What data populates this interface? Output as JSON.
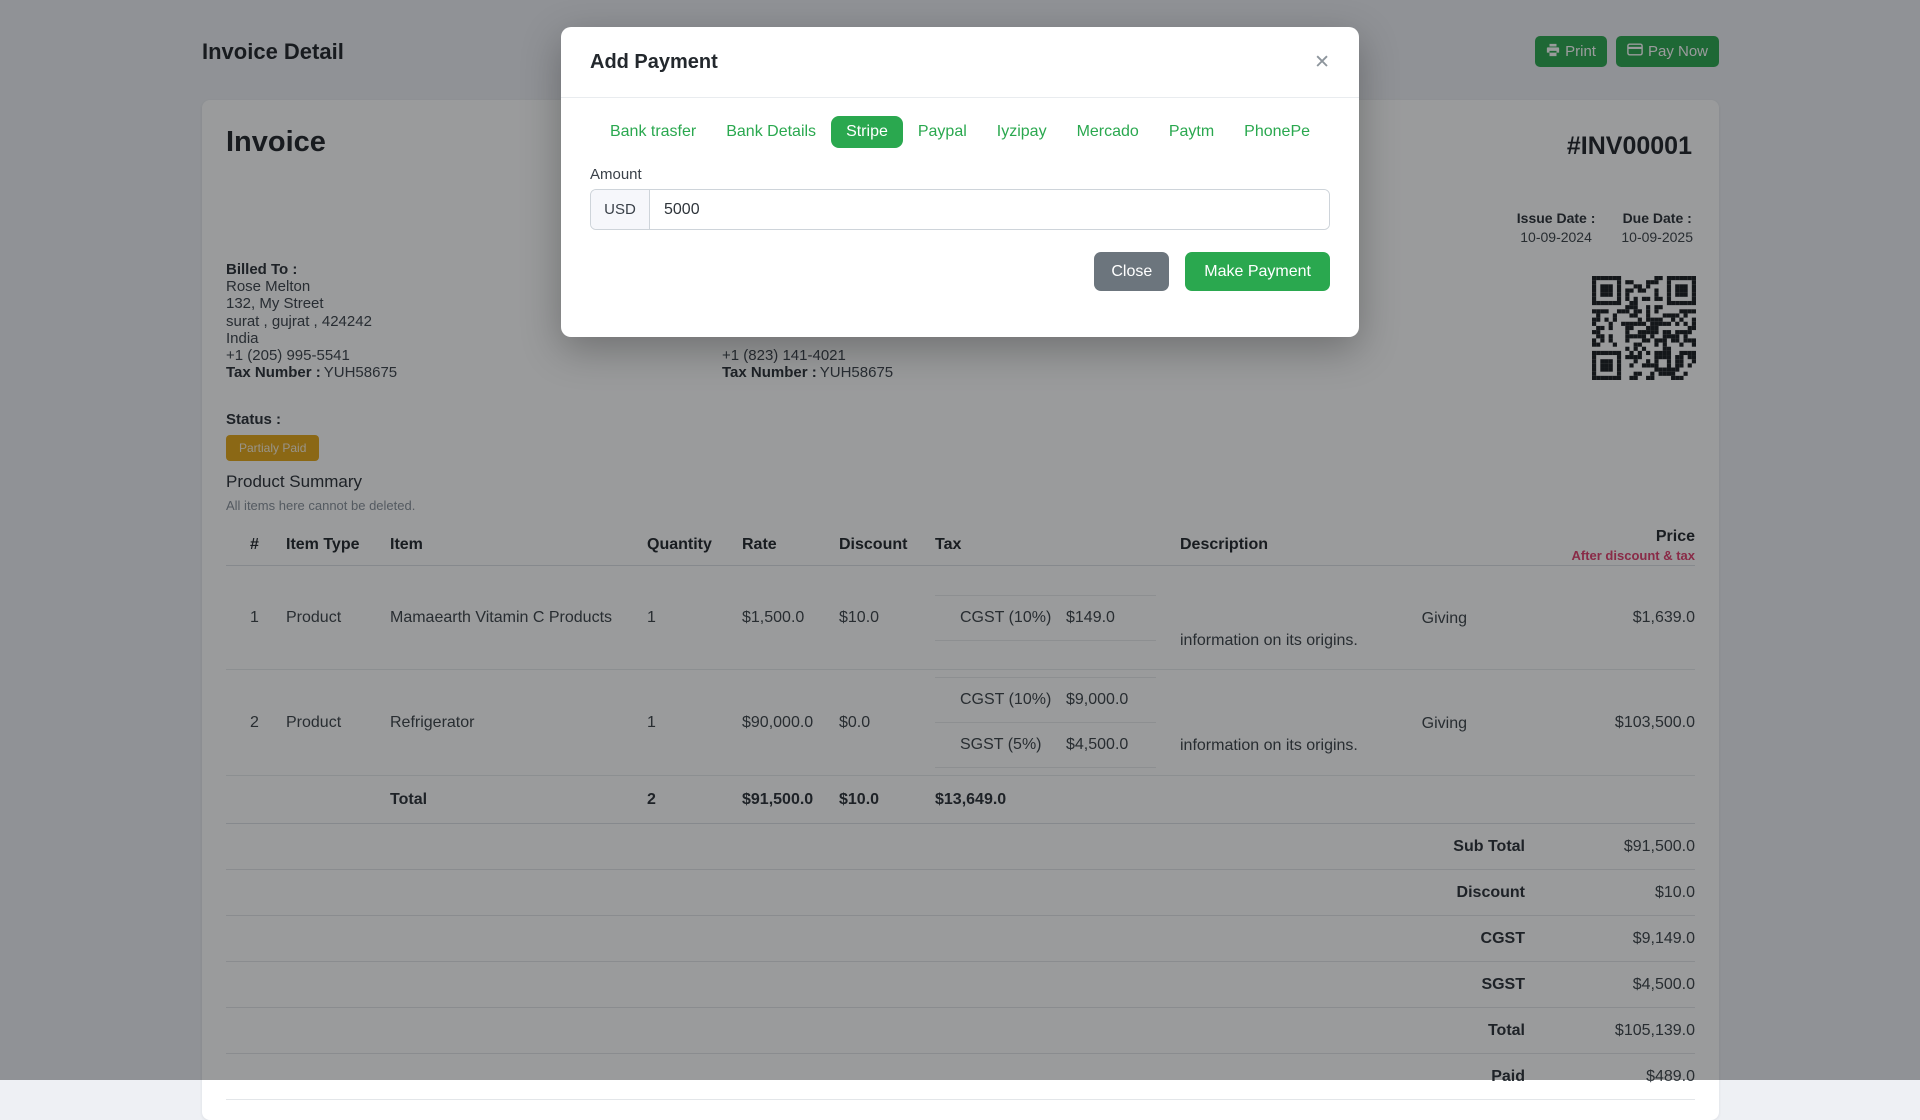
{
  "page": {
    "title": "Invoice Detail"
  },
  "toolbar": {
    "print_label": "Print",
    "pay_now_label": "Pay Now"
  },
  "colors": {
    "accent_green": "#2aa84f",
    "danger_pink": "#e23e6d",
    "warning_orange": "#e6a817",
    "secondary_gray": "#6c757d"
  },
  "invoice": {
    "heading": "Invoice",
    "number": "#INV00001",
    "billed_to": {
      "label": "Billed To :",
      "lines": [
        "Rose Melton",
        "132, My Street",
        "surat , gujrat , 424242",
        "India",
        "+1 (205) 995-5541"
      ],
      "tax_label": "Tax Number :",
      "tax_value": "YUH58675"
    },
    "shipped_to": {
      "phone": "+1 (823) 141-4021",
      "tax_label": "Tax Number :",
      "tax_value": "YUH58675"
    },
    "issue_date": {
      "label": "Issue Date :",
      "value": "10-09-2024"
    },
    "due_date": {
      "label": "Due Date :",
      "value": "10-09-2025"
    },
    "status": {
      "label": "Status :",
      "badge": "Partialy Paid"
    },
    "product_summary": {
      "title": "Product Summary",
      "note": "All items here cannot be deleted."
    }
  },
  "table": {
    "headers": {
      "num": "#",
      "item_type": "Item Type",
      "item": "Item",
      "quantity": "Quantity",
      "rate": "Rate",
      "discount": "Discount",
      "tax": "Tax",
      "description": "Description",
      "price": "Price",
      "price_note": "After discount & tax"
    },
    "rows": [
      {
        "num": "1",
        "item_type": "Product",
        "item": "Mamaearth Vitamin C Products",
        "quantity": "1",
        "rate": "$1,500.0",
        "discount": "$10.0",
        "taxes": [
          {
            "name": "CGST (10%)",
            "value": "$149.0"
          }
        ],
        "desc_lines": [
          "Giving",
          "information on its origins."
        ],
        "price": "$1,639.0"
      },
      {
        "num": "2",
        "item_type": "Product",
        "item": "Refrigerator",
        "quantity": "1",
        "rate": "$90,000.0",
        "discount": "$0.0",
        "taxes": [
          {
            "name": "CGST (10%)",
            "value": "$9,000.0"
          },
          {
            "name": "SGST (5%)",
            "value": "$4,500.0"
          }
        ],
        "desc_lines": [
          "Giving",
          "information on its origins."
        ],
        "price": "$103,500.0"
      }
    ],
    "total_row": {
      "label": "Total",
      "quantity": "2",
      "rate": "$91,500.0",
      "discount": "$10.0",
      "tax": "$13,649.0"
    },
    "summary": [
      {
        "label": "Sub Total",
        "value": "$91,500.0"
      },
      {
        "label": "Discount",
        "value": "$10.0"
      },
      {
        "label": "CGST",
        "value": "$9,149.0"
      },
      {
        "label": "SGST",
        "value": "$4,500.0"
      },
      {
        "label": "Total",
        "value": "$105,139.0"
      },
      {
        "label": "Paid",
        "value": "$489.0"
      }
    ]
  },
  "modal": {
    "title": "Add Payment",
    "close_icon": "✕",
    "tabs": [
      "Bank trasfer",
      "Bank Details",
      "Stripe",
      "Paypal",
      "Iyzipay",
      "Mercado",
      "Paytm",
      "PhonePe"
    ],
    "active_tab": "Stripe",
    "amount_label": "Amount",
    "currency": "USD",
    "amount_value": "5000",
    "close_label": "Close",
    "submit_label": "Make Payment"
  }
}
